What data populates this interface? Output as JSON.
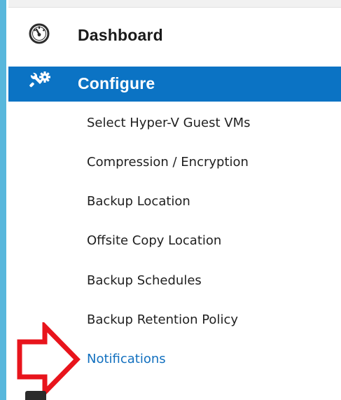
{
  "sidebar": {
    "dashboard": {
      "label": "Dashboard",
      "icon": "dashboard-gauge-icon"
    },
    "configure": {
      "label": "Configure",
      "icon": "tools-gear-icon",
      "selected": true,
      "highlight_color": "#0b73c4"
    },
    "subitems": [
      {
        "label": "Select Hyper-V Guest VMs"
      },
      {
        "label": "Compression / Encryption"
      },
      {
        "label": "Backup Location"
      },
      {
        "label": "Offsite Copy Location"
      },
      {
        "label": "Backup Schedules"
      },
      {
        "label": "Backup Retention Policy"
      },
      {
        "label": "Notifications",
        "active": true
      }
    ]
  },
  "annotation": {
    "icon": "red-arrow-icon",
    "color": "#e8141c",
    "points_to": "Notifications"
  },
  "colors": {
    "left_border": "#58b7dc",
    "active_link": "#1270bf"
  }
}
